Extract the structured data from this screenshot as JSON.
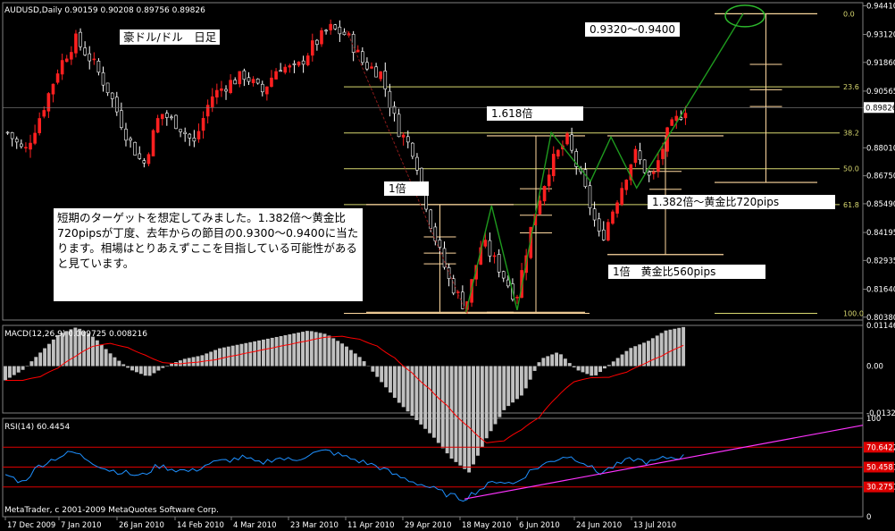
{
  "chart_data": [
    {
      "type": "candlestick",
      "title": "AUDUSD,Daily",
      "ohlc_label": "0.90159 0.90208 0.89756 0.89826",
      "pair_title_jp": "豪ドル/ドル　日足",
      "price_ticks": [
        "0.94410",
        "0.93120",
        "0.91860",
        "0.90565",
        "0.89826",
        "0.88010",
        "0.86750",
        "0.85490",
        "0.84195",
        "0.82935",
        "0.81640",
        "0.80380"
      ],
      "current_price": "0.89826",
      "date_ticks": [
        "17 Dec 2009",
        "7 Jan 2010",
        "26 Jan 2010",
        "14 Feb 2010",
        "4 Mar 2010",
        "23 Mar 2010",
        "11 Apr 2010",
        "29 Apr 2010",
        "18 May 2010",
        "6 Jun 2010",
        "24 Jun 2010",
        "13 Jul 2010"
      ],
      "close_path": [
        0.887,
        0.878,
        0.896,
        0.916,
        0.929,
        0.919,
        0.905,
        0.886,
        0.872,
        0.896,
        0.891,
        0.882,
        0.903,
        0.909,
        0.913,
        0.905,
        0.917,
        0.915,
        0.926,
        0.934,
        0.931,
        0.918,
        0.914,
        0.889,
        0.878,
        0.845,
        0.821,
        0.808,
        0.838,
        0.826,
        0.812,
        0.848,
        0.872,
        0.884,
        0.863,
        0.838,
        0.858,
        0.878,
        0.865,
        0.888,
        0.898
      ],
      "fibonacci": {
        "levels": [
          "0.0",
          "23.6",
          "38.2",
          "50.0",
          "61.8",
          "100.0"
        ],
        "prices": [
          0.9405,
          0.9076,
          0.8868,
          0.8707,
          0.8545,
          0.8055
        ]
      },
      "annotations": {
        "target_box": "0.9320〜0.9400",
        "ratio_1618": "1.618倍",
        "ratio_1": "1倍",
        "ratio_1382": "1.382倍〜黄金比720pips",
        "ratio_1_560": "1倍　黄金比560pips",
        "note": "短期のターゲットを想定してみました。1.382倍〜黄金比720pipsが丁度、去年からの節目の0.9300〜0.9400に当たります。相場はとりあえずここを目指している可能性があると見ています。"
      },
      "colors": {
        "bull": "#ff2020",
        "bear": "#ffffff",
        "fib": "#ffd9a0",
        "level": "#d8d870",
        "wave": "#1e9a1e",
        "circle": "#2db82d"
      }
    },
    {
      "type": "bar",
      "title": "MACD(12,26,9)",
      "values_label": "0.009725 0.008216",
      "ticks": [
        "0.01146",
        "0.00",
        "-0.0132"
      ],
      "histogram": [
        -0.004,
        -0.001,
        0.004,
        0.009,
        0.011,
        0.008,
        0.003,
        -0.001,
        -0.003,
        0.0,
        0.002,
        0.003,
        0.005,
        0.006,
        0.007,
        0.008,
        0.009,
        0.01,
        0.009,
        0.006,
        0.002,
        -0.004,
        -0.01,
        -0.015,
        -0.02,
        -0.026,
        -0.03,
        -0.02,
        -0.012,
        -0.008,
        0.002,
        0.004,
        -0.001,
        -0.003,
        0.001,
        0.005,
        0.007,
        0.01,
        0.011
      ],
      "colors": {
        "histogram": "#c0c0c0",
        "signal": "#ff0000"
      }
    },
    {
      "type": "line",
      "title": "RSI(14)",
      "value_label": "60.4454",
      "ticks": [
        "100",
        "70.6422",
        "50.4581",
        "30.2751",
        "0"
      ],
      "levels": [
        70.6422,
        50.4581,
        30.2751
      ],
      "rsi": [
        43,
        35,
        52,
        60,
        66,
        57,
        48,
        45,
        41,
        52,
        48,
        46,
        54,
        57,
        60,
        54,
        60,
        57,
        64,
        67,
        61,
        56,
        51,
        42,
        36,
        30,
        23,
        18,
        28,
        37,
        33,
        47,
        55,
        62,
        57,
        44,
        52,
        59,
        55,
        60,
        61
      ],
      "colors": {
        "rsi": "#1e90ff",
        "levels": "#dd0000",
        "trendline": "#ff33ff"
      }
    }
  ],
  "footer": {
    "copyright": "MetaTrader, c 2001-2009 MetaQuotes Software Corp."
  }
}
